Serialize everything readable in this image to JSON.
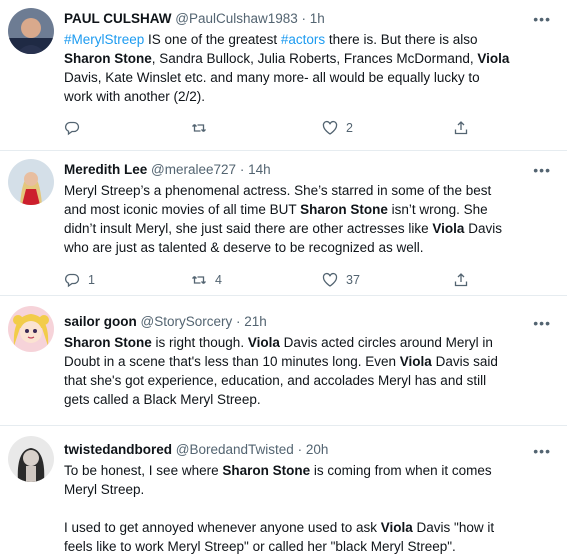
{
  "tweets": [
    {
      "name": "PAUL CULSHAW",
      "handle": "@PaulCulshaw1983",
      "time": "1h",
      "lines": [
        [
          {
            "t": "#MerylStreep",
            "c": "tag"
          },
          {
            "t": " IS one of the greatest "
          },
          {
            "t": "#actors",
            "c": "tag"
          },
          {
            "t": " there is. But there is also"
          }
        ],
        [
          {
            "t": "Sharon Stone",
            "c": "b"
          },
          {
            "t": ", Sandra Bullock, Julia Roberts, Frances McDormand, "
          },
          {
            "t": "Viola",
            "c": "b"
          }
        ],
        [
          {
            "t": "Davis, Kate Winslet etc. and many more- all would be equally lucky to"
          }
        ],
        [
          {
            "t": "work with another (2/2)."
          }
        ]
      ],
      "replies": "",
      "retweets": "",
      "likes": "2"
    },
    {
      "name": "Meredith Lee",
      "handle": "@meralee727",
      "time": "14h",
      "lines": [
        [
          {
            "t": "Meryl Streep’s a phenomenal actress. She’s starred in some of the best"
          }
        ],
        [
          {
            "t": "and most iconic movies of all time BUT "
          },
          {
            "t": "Sharon Stone",
            "c": "b"
          },
          {
            "t": " isn’t wrong. She"
          }
        ],
        [
          {
            "t": "didn’t insult Meryl, she just said there are other actresses like "
          },
          {
            "t": "Viola",
            "c": "b"
          },
          {
            "t": " Davis"
          }
        ],
        [
          {
            "t": "who are just as talented & deserve to be recognized as well."
          }
        ]
      ],
      "replies": "1",
      "retweets": "4",
      "likes": "37"
    },
    {
      "name": "sailor goon",
      "handle": "@StorySorcery",
      "time": "21h",
      "lines": [
        [
          {
            "t": "Sharon Stone",
            "c": "b"
          },
          {
            "t": " is right though. "
          },
          {
            "t": "Viola",
            "c": "b"
          },
          {
            "t": " Davis acted circles around Meryl in"
          }
        ],
        [
          {
            "t": "Doubt in a scene that's less than 10 minutes long. Even "
          },
          {
            "t": "Viola",
            "c": "b"
          },
          {
            "t": " Davis said"
          }
        ],
        [
          {
            "t": "that she's got experience, education, and accolades Meryl has and still"
          }
        ],
        [
          {
            "t": "gets called a Black Meryl Streep."
          }
        ]
      ]
    },
    {
      "name": "twistedandbored",
      "handle": "@BoredandTwisted",
      "time": "20h",
      "lines": [
        [
          {
            "t": "To be honest, I see where "
          },
          {
            "t": "Sharon Stone",
            "c": "b"
          },
          {
            "t": " is coming from when it comes"
          }
        ],
        [
          {
            "t": "Meryl Streep."
          }
        ],
        [
          {
            "t": " "
          }
        ],
        [
          {
            "t": "I used to get annoyed whenever anyone used to ask "
          },
          {
            "t": "Viola",
            "c": "b"
          },
          {
            "t": " Davis \"how it"
          }
        ],
        [
          {
            "t": "feels like to work Meryl Streep\" or called her \"black Meryl Streep\"."
          }
        ]
      ]
    }
  ],
  "ui": {
    "more": "•••",
    "sep": " · "
  }
}
